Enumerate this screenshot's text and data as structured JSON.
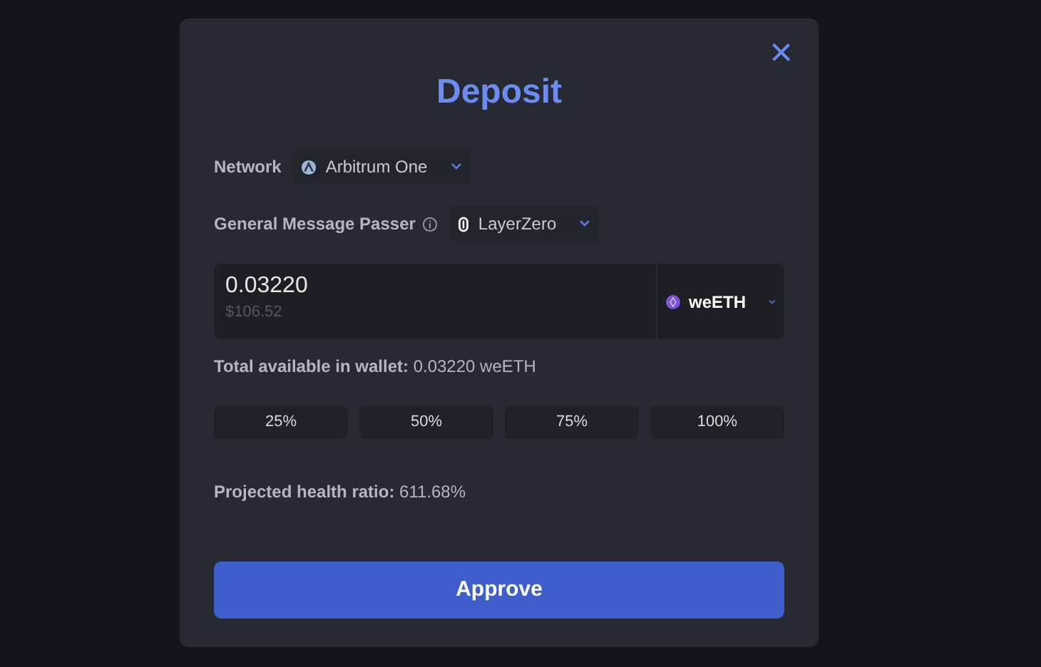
{
  "dialog": {
    "title": "Deposit",
    "close": "×"
  },
  "network": {
    "label": "Network",
    "value": "Arbitrum One"
  },
  "message_passer": {
    "label": "General Message Passer",
    "value": "LayerZero"
  },
  "amount": {
    "value": "0.03220",
    "usd": "$106.52",
    "token": "weETH"
  },
  "available": "**Total available in wallet:** 0.03220 weETH",
  "percent_buttons": [
    "25%",
    "50%",
    "75%",
    "100%"
  ],
  "health": "**Projected health ratio:** 611.68%",
  "action": "Approve"
}
